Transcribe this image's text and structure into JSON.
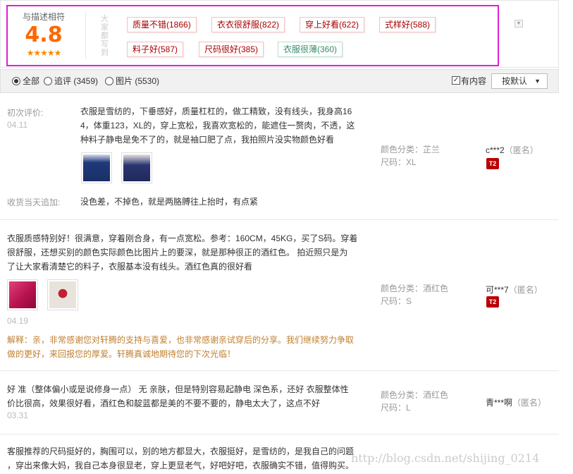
{
  "rating": {
    "label": "与描述相符",
    "score": "4.8",
    "stars": "★★★★★",
    "star_count": 5
  },
  "everyone_says": "大家都写到",
  "tags": [
    {
      "text": "质量不错(1866)",
      "sentiment": "positive"
    },
    {
      "text": "衣衣很舒服(822)",
      "sentiment": "positive"
    },
    {
      "text": "穿上好看(622)",
      "sentiment": "positive"
    },
    {
      "text": "式样好(588)",
      "sentiment": "positive"
    },
    {
      "text": "料子好(587)",
      "sentiment": "positive"
    },
    {
      "text": "尺码很好(385)",
      "sentiment": "positive"
    },
    {
      "text": "衣服很薄(360)",
      "sentiment": "negative"
    }
  ],
  "filters": {
    "all": "全部",
    "followup": "追评 (3459)",
    "pictures": "图片 (5530)",
    "has_content": "有内容",
    "sort": "按默认",
    "selected": "all"
  },
  "reviews": [
    {
      "first_label": "初次评价:",
      "first_date": "04.11",
      "text_lines": [
        "衣服是雪纺的，下垂感好，质量杠杠的，做工精致，没有线头，我身高16",
        "4，体重123，XL的，穿上宽松，我喜欢宽松的，能遮住一赘肉，不透，这",
        "种料子静电是免不了的，就是袖口肥了点，我拍照片没实物颜色好看"
      ],
      "images": [
        "navy-blouse-photo-1",
        "navy-blouse-photo-2"
      ],
      "followup_label": "收货当天追加:",
      "followup_text": "没色差，不掉色，就是两胳膊往上抬时，有点紧",
      "sku_color_label": "颜色分类：",
      "sku_color": "芷兰",
      "sku_size_label": "尺码：",
      "sku_size": "XL",
      "user": "c***2",
      "anon": "（匿名）",
      "badge": "T2"
    },
    {
      "text_lines": [
        "衣服质感特别好！很满意，穿着刚合身，有一点宽松。参考：160CM，45KG，买了S码。穿着",
        "很舒服，还想买别的颜色实际颜色比图片上的要深，就是那种很正的酒红色。 拍近照只是为",
        "了让大家看清楚它的料子，衣服基本没有线头。酒红色真的很好看"
      ],
      "images": [
        "wine-red-fabric-photo",
        "person-wearing-photo"
      ],
      "date": "04.19",
      "reply_lines": [
        "解释：亲，非常感谢您对轩腾的支持与喜爱，也非常感谢亲试穿后的分享。我们继续努力争取",
        "做的更好，来回报您的厚爱。轩腾真诚地期待您的下次光临！"
      ],
      "sku_color_label": "颜色分类：",
      "sku_color": "酒红色",
      "sku_size_label": "尺码：",
      "sku_size": "S",
      "user": "可***7",
      "anon": "（匿名）",
      "badge": "T2"
    },
    {
      "text_lines": [
        "好 准（整体偏小或是说修身一点） 无 亲肤，但是特别容易起静电 深色系，还好 衣服整体性",
        "价比很高，效果很好看，酒红色和靛蓝都是美的不要不要的，静电太大了，这点不好"
      ],
      "date": "03.31",
      "sku_color_label": "颜色分类：",
      "sku_color": "酒红色",
      "sku_size_label": "尺码：",
      "sku_size": "L",
      "user": "青***啊",
      "anon": "（匿名）"
    },
    {
      "text_lines": [
        "客服推荐的尺码挺好的，胸围可以，别的地方都显大，衣服挺好，是雪纺的，是我自己的问题",
        "，穿出来像大妈，我自己本身很显老，穿上更显老气，好吧好吧，衣服确实不错，值得购买。"
      ]
    }
  ],
  "watermark": "http://blog.csdn.net/shijing_0214",
  "colors": {
    "score": "#ff6600",
    "highlight": "#e020d0",
    "tag_positive": "#aa0000",
    "tag_negative": "#3a8a6a",
    "reply": "#c08030"
  }
}
